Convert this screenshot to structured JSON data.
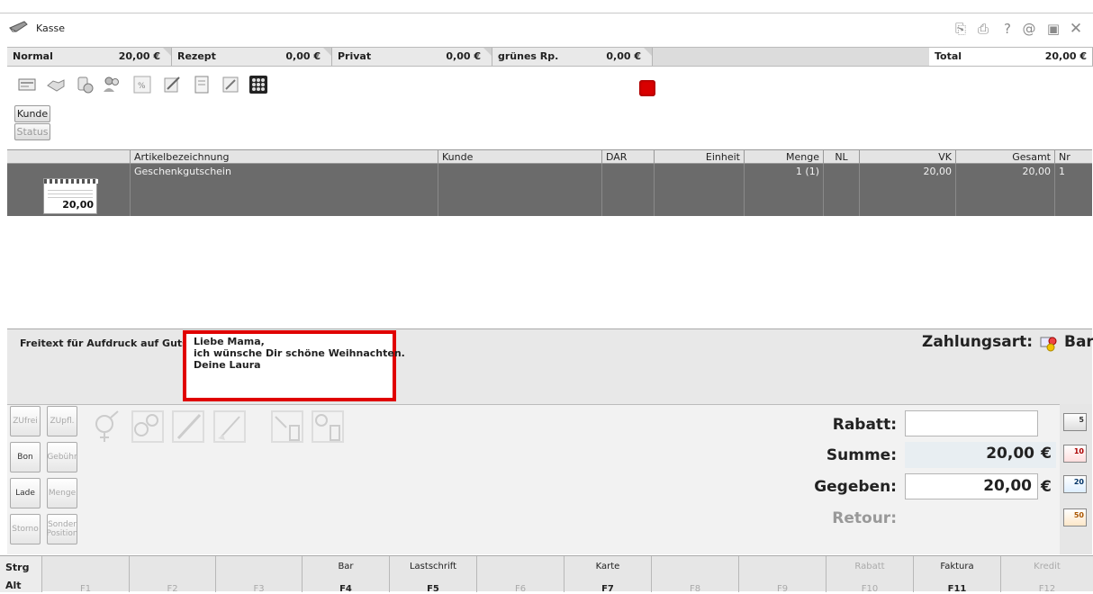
{
  "window": {
    "title": "Kasse",
    "icons": [
      "clipboard-icon",
      "print-icon",
      "help-icon",
      "at-icon",
      "minimize-icon",
      "close-icon"
    ],
    "icon_glyphs": [
      "⎘",
      "⎙",
      "?",
      "@",
      "▣",
      "✕"
    ]
  },
  "tabs": [
    {
      "label": "Normal",
      "amount": "20,00 €"
    },
    {
      "label": "Rezept",
      "amount": "0,00 €"
    },
    {
      "label": "Privat",
      "amount": "0,00 €"
    },
    {
      "label": "grünes Rp.",
      "amount": "0,00 €"
    }
  ],
  "total": {
    "label": "Total",
    "amount": "20,00 €"
  },
  "toolbar": {
    "customer_button": "Kunde",
    "status_button": "Status",
    "icons": [
      "card-reader-icon",
      "handshake-icon",
      "pills-icon",
      "people-icon",
      "discount-icon",
      "pen-receipt-icon",
      "document-icon",
      "signpost-icon",
      "grid-icon"
    ]
  },
  "table": {
    "columns": [
      "Artikelbezeichnung",
      "Kunde",
      "DAR",
      "Einheit",
      "Menge",
      "NL",
      "VK",
      "Gesamt",
      "Nr"
    ],
    "rows": [
      {
        "image_amount": "20,00",
        "article": "Geschenkgutschein",
        "customer": "",
        "dar": "",
        "unit": "",
        "quantity": "1 (1)",
        "nl": "",
        "vk": "20,00",
        "total": "20,00",
        "nr": "1"
      }
    ]
  },
  "freetext": {
    "label": "Freitext für Aufdruck auf Gutschein:",
    "value": "Liebe Mama,\nich wünsche Dir schöne Weihnachten.\nDeine Laura"
  },
  "payment": {
    "label": "Zahlungsart:",
    "value": "Bar"
  },
  "side_buttons": [
    {
      "label": "ZUfrei",
      "enabled": false
    },
    {
      "label": "ZUpfl.",
      "enabled": false
    },
    {
      "label": "Bon",
      "enabled": true
    },
    {
      "label": "Gebühr",
      "enabled": false
    },
    {
      "label": "Lade",
      "enabled": true
    },
    {
      "label": "Menge",
      "enabled": false
    },
    {
      "label": "Storno",
      "enabled": false
    },
    {
      "label": "Sonder Position",
      "enabled": false
    }
  ],
  "summary": {
    "discount_label": "Rabatt:",
    "discount_value": "",
    "sum_label": "Summe:",
    "sum_value": "20,00",
    "currency": "€",
    "given_label": "Gegeben:",
    "given_value": "20,00",
    "return_label": "Retour:",
    "return_value": ""
  },
  "money_buttons": [
    "5",
    "10",
    "20",
    "50"
  ],
  "function_keys": {
    "modifiers": [
      "Strg",
      "Alt"
    ],
    "keys": [
      {
        "key": "F1",
        "caption": "",
        "enabled": false
      },
      {
        "key": "F2",
        "caption": "",
        "enabled": false
      },
      {
        "key": "F3",
        "caption": "",
        "enabled": false
      },
      {
        "key": "F4",
        "caption": "Bar",
        "enabled": true
      },
      {
        "key": "F5",
        "caption": "Lastschrift",
        "enabled": true
      },
      {
        "key": "F6",
        "caption": "",
        "enabled": false
      },
      {
        "key": "F7",
        "caption": "Karte",
        "enabled": true
      },
      {
        "key": "F8",
        "caption": "",
        "enabled": false
      },
      {
        "key": "F9",
        "caption": "",
        "enabled": false
      },
      {
        "key": "F10",
        "caption": "Rabatt",
        "enabled": false
      },
      {
        "key": "F11",
        "caption": "Faktura",
        "enabled": true
      },
      {
        "key": "F12",
        "caption": "Kredit",
        "enabled": false
      }
    ]
  },
  "colors": {
    "accent_red": "#e00000",
    "selected_row": "#6b6b6b",
    "indicator": "#d90000"
  }
}
